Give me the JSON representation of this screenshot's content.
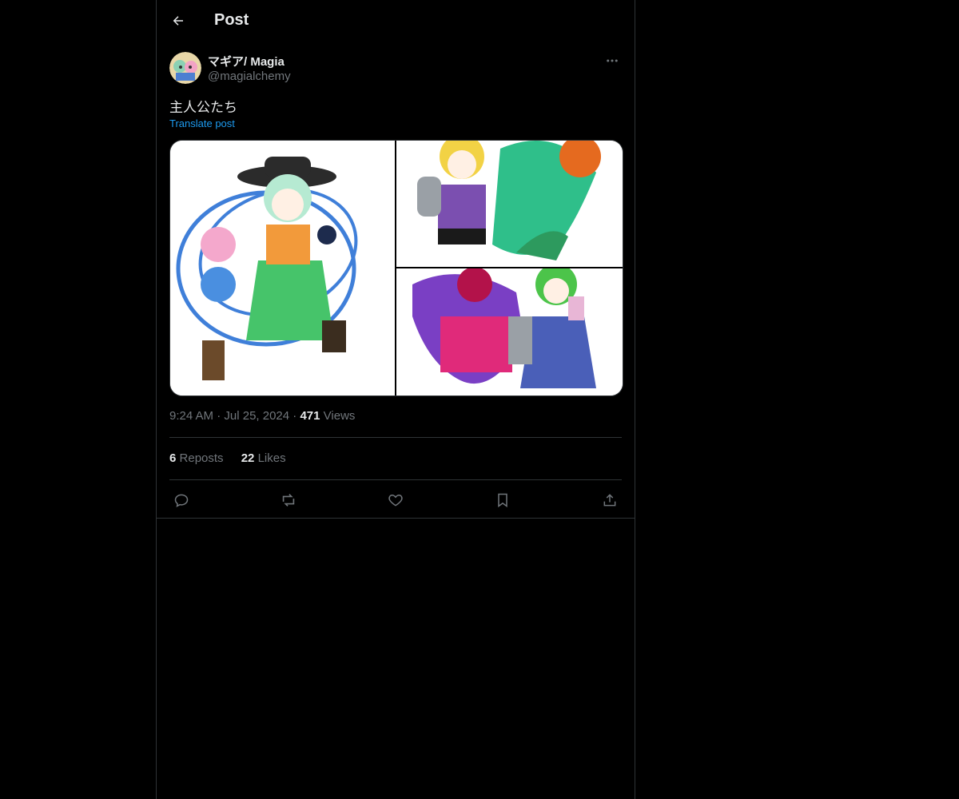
{
  "header": {
    "title": "Post",
    "back_icon": "arrow-left-icon"
  },
  "author": {
    "display_name": "マギア/ Magia",
    "handle": "@magialchemy"
  },
  "post": {
    "text": "主人公たち",
    "translate_label": "Translate post",
    "time": "9:24 AM",
    "date": "Jul 25, 2024",
    "views_count": "471",
    "views_label": "Views"
  },
  "stats": {
    "reposts_count": "6",
    "reposts_label": "Reposts",
    "likes_count": "22",
    "likes_label": "Likes"
  },
  "actions": [
    "reply-icon",
    "repost-icon",
    "like-icon",
    "bookmark-icon",
    "share-icon"
  ],
  "colors": {
    "background": "#000000",
    "text": "#e7e9ea",
    "muted": "#71767b",
    "accent": "#1d9bf0",
    "border": "#2f3336"
  }
}
